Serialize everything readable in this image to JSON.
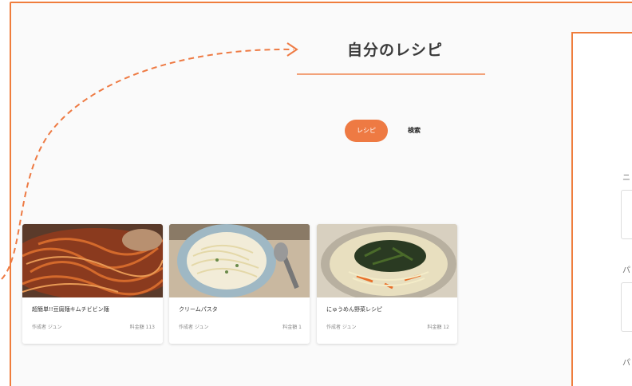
{
  "page": {
    "title": "自分のレシピ",
    "accent_color": "#ee7a43"
  },
  "tabs": [
    {
      "label": "レシピ",
      "active": true
    },
    {
      "label": "検索",
      "active": false
    }
  ],
  "recipes": [
    {
      "name": "超簡単!!豆腐麺キムチビビン麺",
      "author": "作成者 ジュン",
      "likes": "料金額 113"
    },
    {
      "name": "クリームパスタ",
      "author": "作成者 ジュン",
      "likes": "料金額 1"
    },
    {
      "name": "にゅうめん野菜レシピ",
      "author": "作成者 ジュン",
      "likes": "料金額 12"
    }
  ],
  "form": {
    "label_1": "ニ",
    "label_2": "パ",
    "label_3": "パ"
  },
  "icons": {
    "arrow": "dashed-curve-arrow-icon"
  }
}
